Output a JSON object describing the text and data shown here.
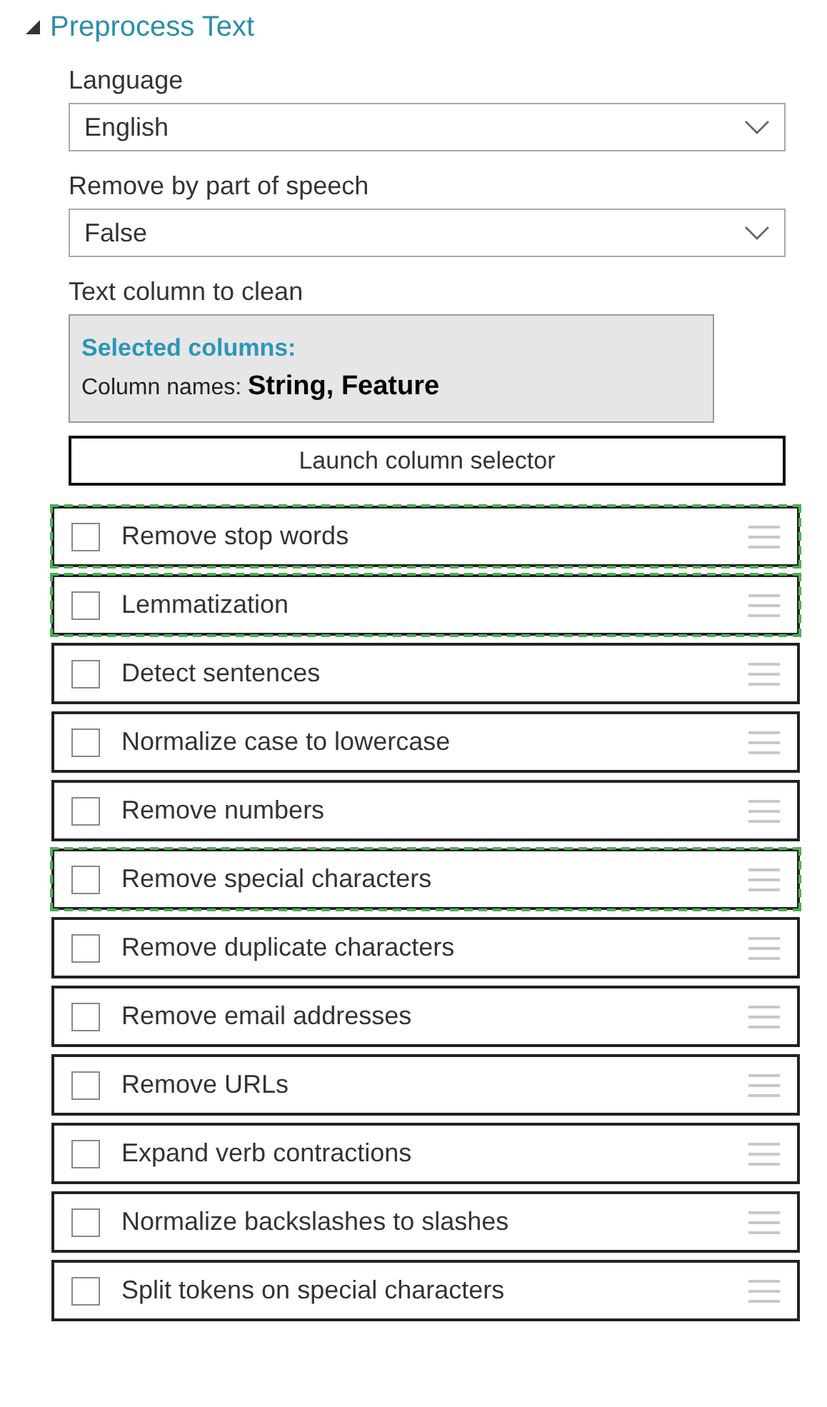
{
  "section": {
    "title": "Preprocess Text",
    "expanded": true
  },
  "fields": [
    {
      "label": "Language",
      "value": "English"
    },
    {
      "label": "Remove by part of speech",
      "value": "False"
    }
  ],
  "column_picker": {
    "label": "Text column to clean",
    "heading": "Selected columns:",
    "summary": "Column names: **String, Feature**",
    "button": "Launch column selector"
  },
  "options": [
    {
      "label": "Remove stop words",
      "checked": false,
      "highlighted": true
    },
    {
      "label": "Lemmatization",
      "checked": false,
      "highlighted": true
    },
    {
      "label": "Detect sentences",
      "checked": false,
      "highlighted": false
    },
    {
      "label": "Normalize case to lowercase",
      "checked": false,
      "highlighted": false
    },
    {
      "label": "Remove numbers",
      "checked": false,
      "highlighted": false
    },
    {
      "label": "Remove special characters",
      "checked": false,
      "highlighted": true
    },
    {
      "label": "Remove duplicate characters",
      "checked": false,
      "highlighted": false
    },
    {
      "label": "Remove email addresses",
      "checked": false,
      "highlighted": false
    },
    {
      "label": "Remove URLs",
      "checked": false,
      "highlighted": false
    },
    {
      "label": "Expand verb contractions",
      "checked": false,
      "highlighted": false
    },
    {
      "label": "Normalize backslashes to slashes",
      "checked": false,
      "highlighted": false
    },
    {
      "label": "Split tokens on special characters",
      "checked": false,
      "highlighted": false
    }
  ]
}
